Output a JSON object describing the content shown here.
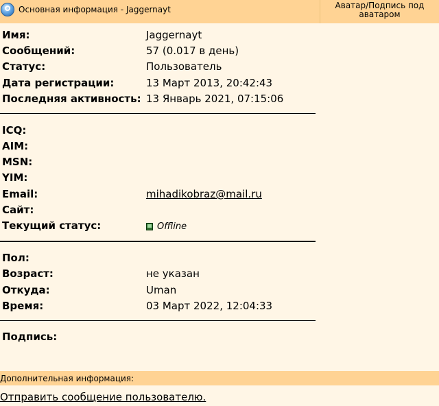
{
  "header": {
    "title": "Основная информация - Jaggernayt",
    "right_title": "Аватар/Подпись под аватаром"
  },
  "profile": [
    {
      "label": "Имя:",
      "value": "Jaggernayt"
    },
    {
      "label": "Сообщений:",
      "value": "57 (0.017 в день)"
    },
    {
      "label": "Статус:",
      "value": "Пользователь"
    },
    {
      "label": "Дата регистрации:",
      "value": "13 Март 2013, 20:42:43"
    },
    {
      "label": "Последняя активность:",
      "value": "13 Январь 2021, 07:15:06"
    }
  ],
  "contacts": [
    {
      "label": "ICQ:",
      "value": ""
    },
    {
      "label": "AIM:",
      "value": ""
    },
    {
      "label": "MSN:",
      "value": ""
    },
    {
      "label": "YIM:",
      "value": ""
    },
    {
      "label": "Email:",
      "value": "mihadikobraz@mail.ru"
    },
    {
      "label": "Сайт:",
      "value": ""
    },
    {
      "label": "Текущий статус:",
      "value": "Offline"
    }
  ],
  "personal": [
    {
      "label": "Пол:",
      "value": ""
    },
    {
      "label": "Возраст:",
      "value": "не указан"
    },
    {
      "label": "Откуда:",
      "value": "Uman"
    },
    {
      "label": "Время:",
      "value": "03 Март 2022, 12:04:33"
    }
  ],
  "signature": {
    "label": "Подпись:"
  },
  "additional": {
    "title": "Дополнительная информация:",
    "send_message_link": "Отправить сообщение пользователю."
  },
  "colors": {
    "header_bg": "#ffd394",
    "panel_bg": "#fff6e6"
  }
}
